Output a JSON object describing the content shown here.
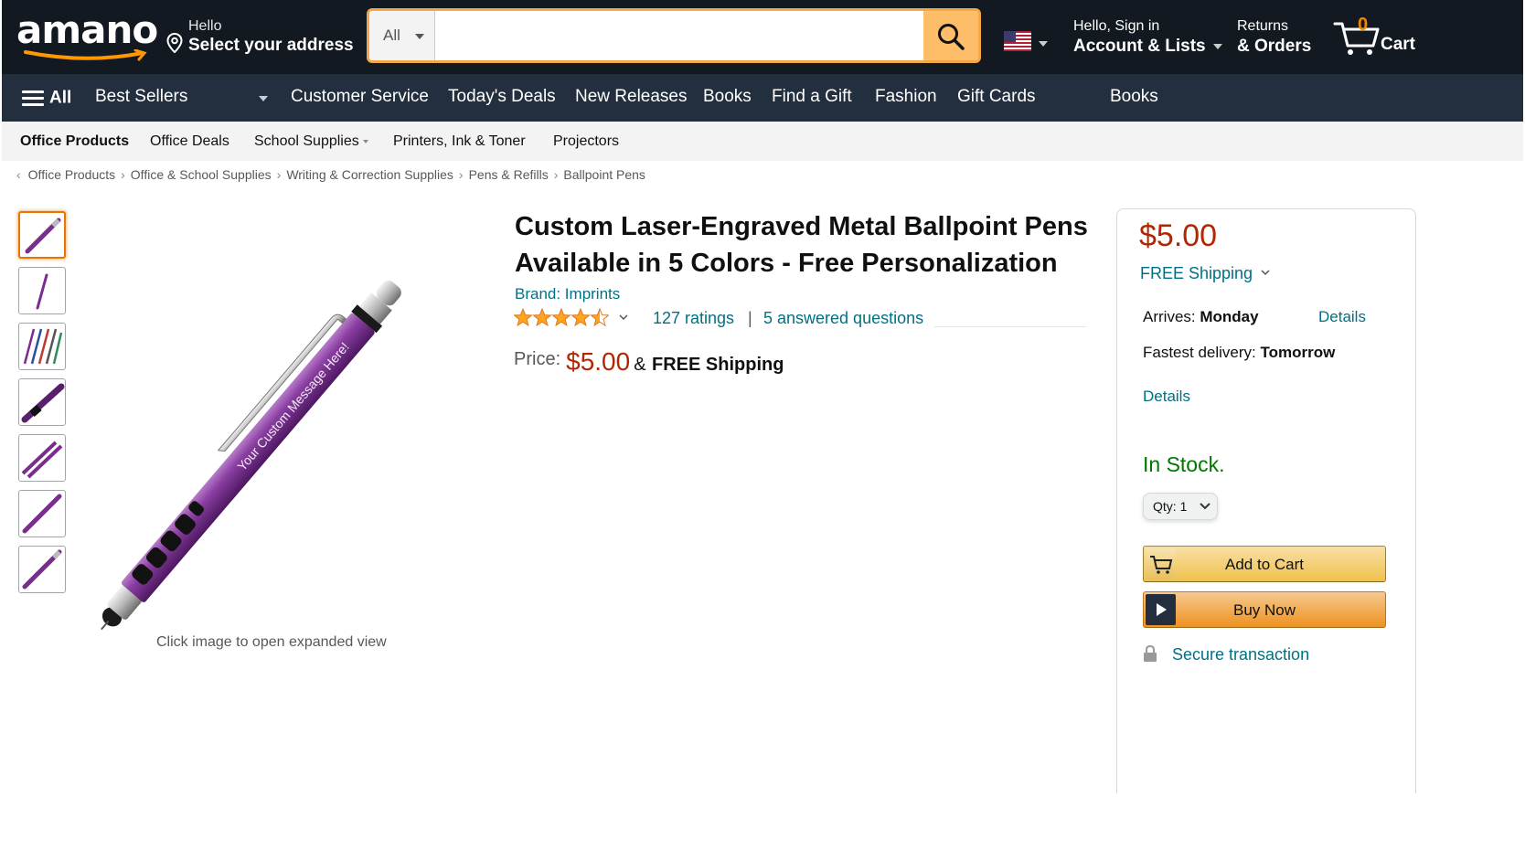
{
  "header": {
    "logo_text": "amano",
    "address_greeting": "Hello",
    "address_label": "Select your address",
    "search": {
      "category": "All",
      "placeholder": "",
      "value": ""
    },
    "account_greeting": "Hello, Sign in",
    "account_label": "Account & Lists",
    "returns_label": "Returns",
    "orders_label": "& Orders",
    "cart_count": "0",
    "cart_label": "Cart",
    "colors": {
      "nav_dark": "#131921",
      "nav_secondary": "#232f3e",
      "search_button": "#febd69",
      "search_border": "#f3a847",
      "cart_count": "#f08804"
    }
  },
  "nav": {
    "all_label": "All",
    "items": [
      "Best Sellers",
      "Customer Service",
      "Today's Deals",
      "New Releases",
      "Books",
      "Find a Gift",
      "Fashion",
      "Gift Cards",
      "Books"
    ]
  },
  "subnav": {
    "items": [
      "Office Products",
      "Office Deals",
      "School Supplies",
      "Printers, Ink & Toner",
      "Projectors"
    ]
  },
  "breadcrumb": [
    "Office Products",
    "Office & School Supplies",
    "Writing & Correction Supplies",
    "Pens & Refills",
    "Ballpoint Pens"
  ],
  "gallery": {
    "thumbnail_count": 7,
    "engraving_text": "Your Custom Message Here!",
    "caption": "Click image to open expanded view",
    "pen_color": "#7b2d8e"
  },
  "product": {
    "title_line1": "Custom Laser-Engraved Metal Ballpoint Pens",
    "title_line2": "Available in 5 Colors - Free Personalization",
    "brand": "Brand: Imprints",
    "star_rating": 4.5,
    "ratings_count": "127 ratings",
    "separator": "|",
    "answered_questions": "5 answered questions",
    "price_label": "Price:",
    "price": "$5.00",
    "price_ampersand": "&",
    "price_shipping": "FREE Shipping"
  },
  "buybox": {
    "price": "$5.00",
    "shipping": "FREE Shipping",
    "arrives_label": "Arrives:",
    "arrives_day": "Monday",
    "details_link": "Details",
    "fastest_label": "Fastest delivery:",
    "fastest_day": "Tomorrow",
    "details_link_2": "Details",
    "stock": "In Stock.",
    "qty_label": "Qty:",
    "qty_value": "1",
    "add_to_cart": "Add to Cart",
    "buy_now": "Buy Now",
    "secure": "Secure transaction",
    "colors": {
      "price": "#b12704",
      "link": "#007185",
      "in_stock": "#007600"
    }
  }
}
